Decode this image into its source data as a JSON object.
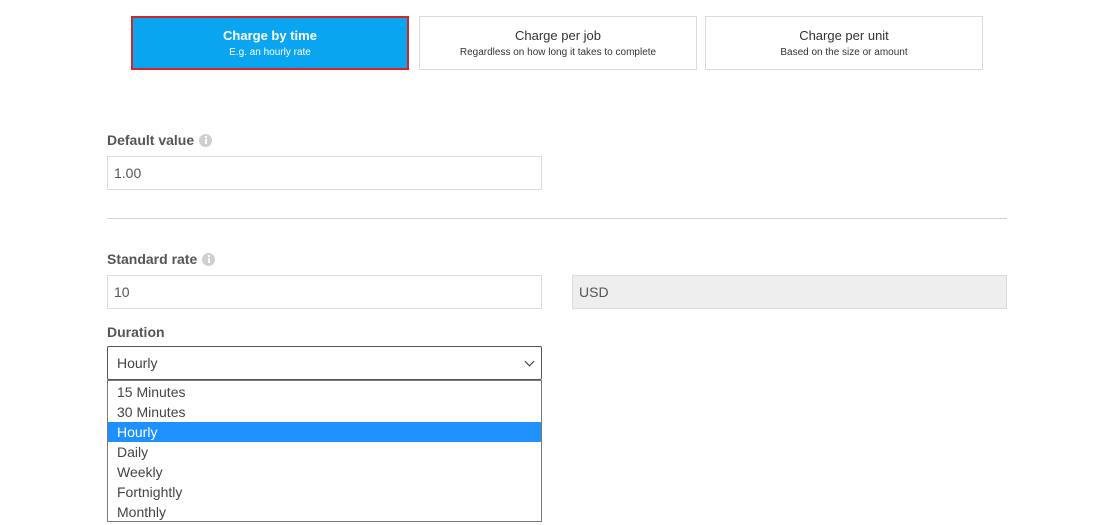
{
  "charge_options": [
    {
      "title": "Charge by time",
      "subtitle": "E.g. an hourly rate",
      "active": true
    },
    {
      "title": "Charge per job",
      "subtitle": "Regardless on how long it takes to complete",
      "active": false
    },
    {
      "title": "Charge per unit",
      "subtitle": "Based on the size or amount",
      "active": false
    }
  ],
  "default_value": {
    "label": "Default value",
    "value": "1.00"
  },
  "standard_rate": {
    "label": "Standard rate",
    "value": "10",
    "currency": "USD"
  },
  "duration": {
    "label": "Duration",
    "selected": "Hourly",
    "options": [
      "15 Minutes",
      "30 Minutes",
      "Hourly",
      "Daily",
      "Weekly",
      "Fortnightly",
      "Monthly"
    ]
  },
  "colors": {
    "accent": "#0aa5f0",
    "active_border": "#d62525",
    "option_highlight": "#1e90ff"
  },
  "icons": {
    "info": "info-icon",
    "dropdown": "chevron-down-icon"
  }
}
